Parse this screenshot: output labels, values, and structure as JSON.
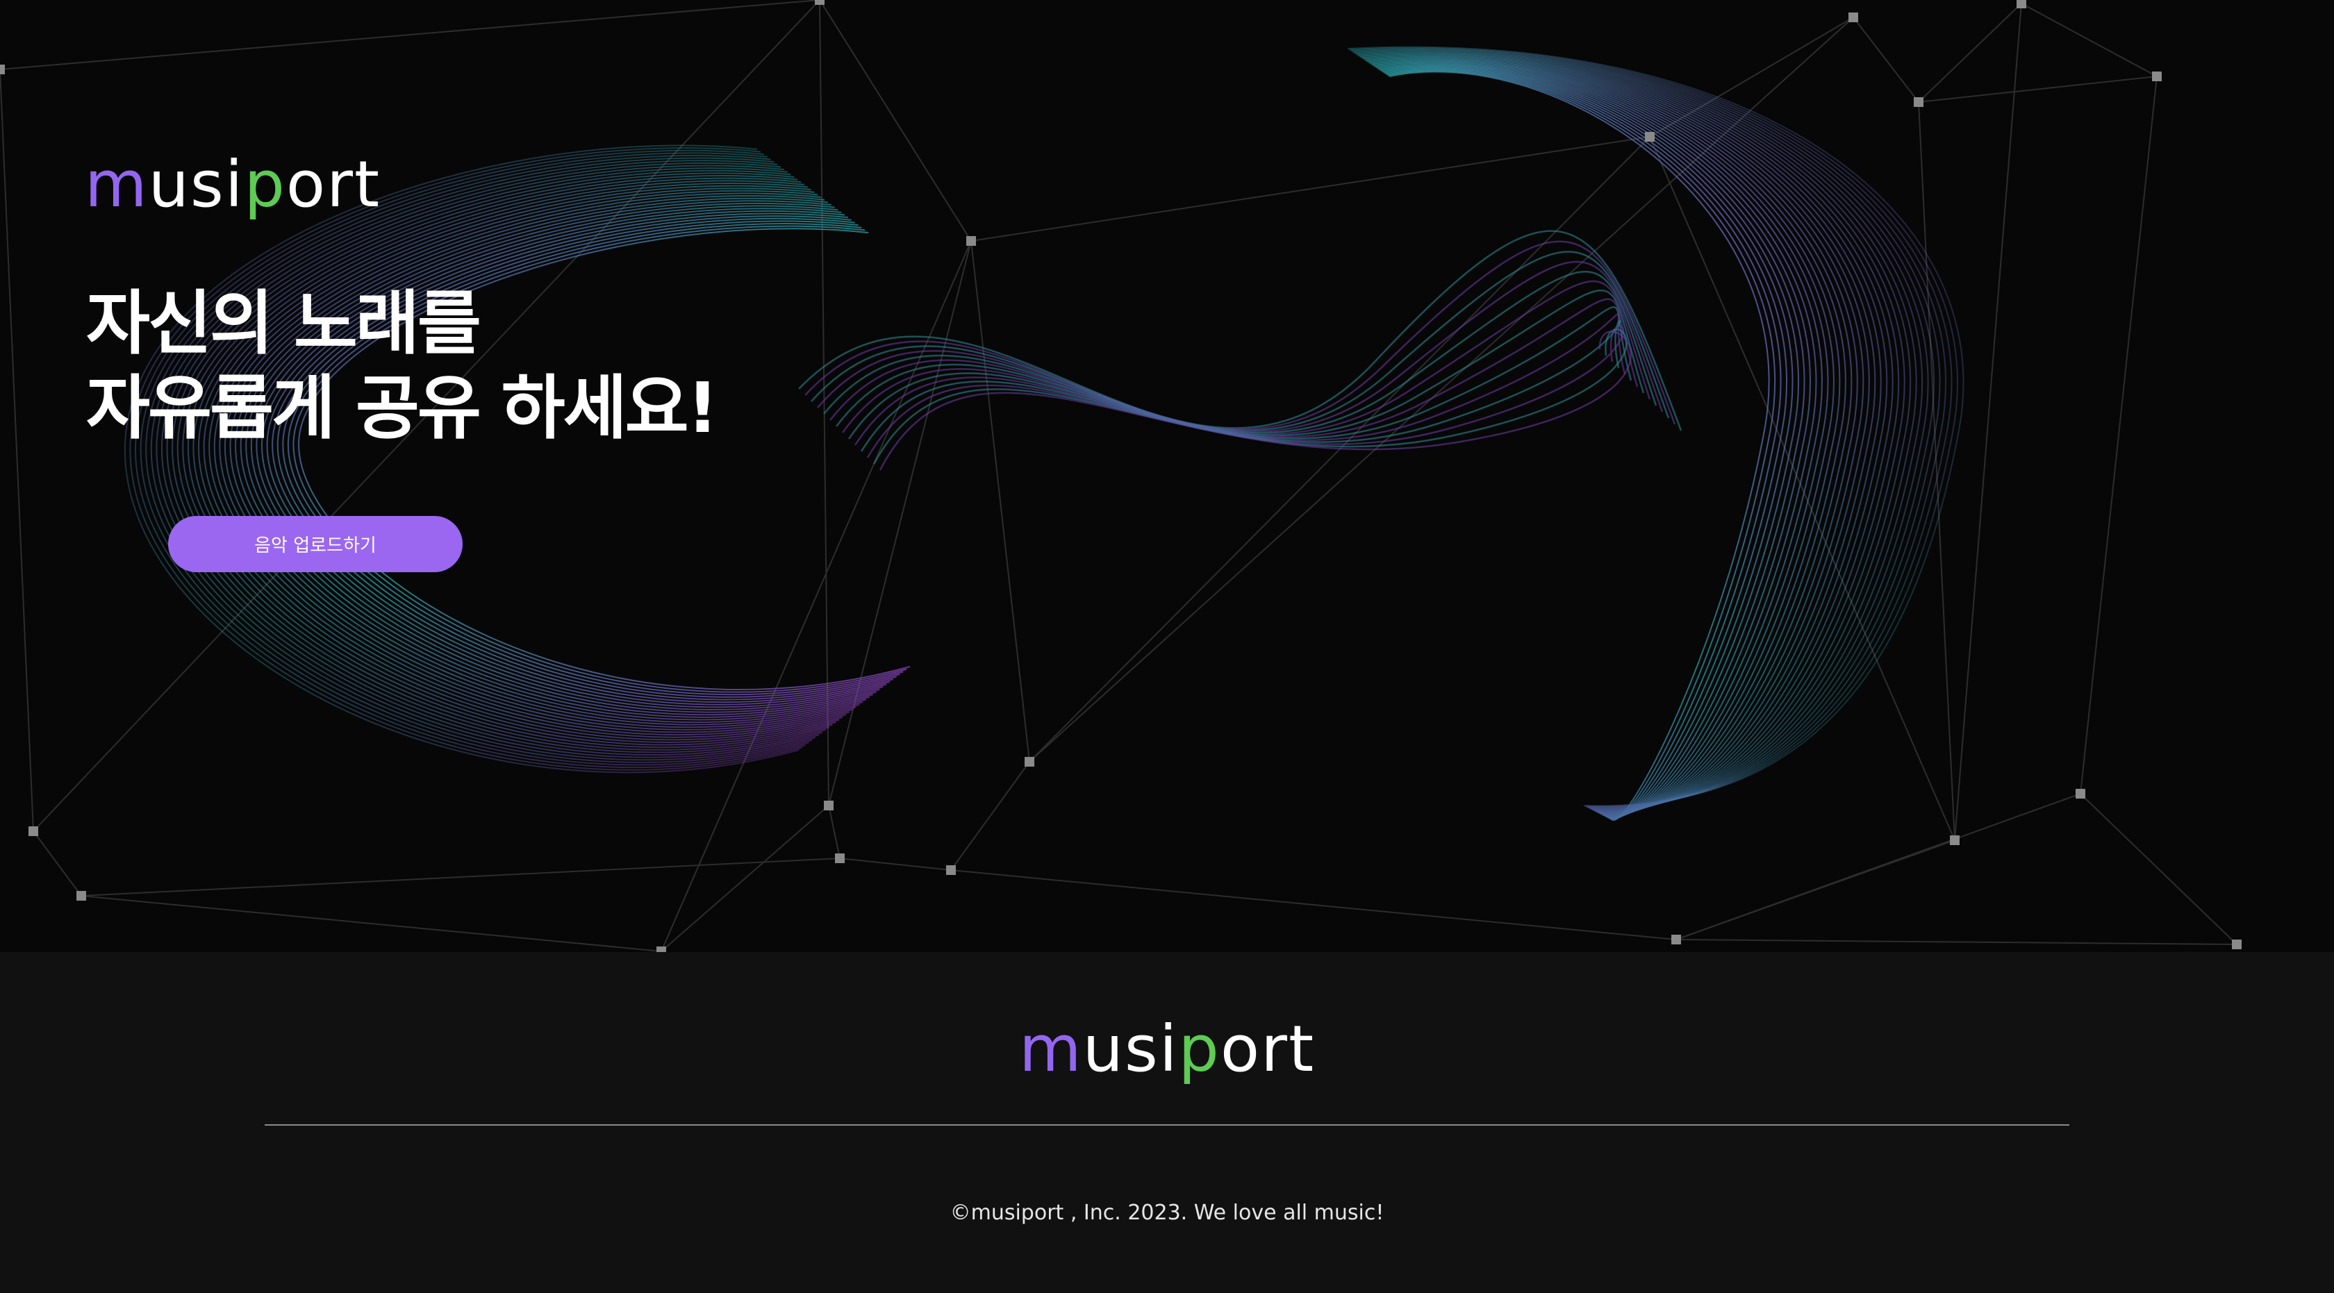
{
  "brand": {
    "logo_m": "m",
    "logo_usi": "usi",
    "logo_p": "p",
    "logo_ort": "ort",
    "accent_purple": "#9466f0",
    "accent_green": "#5ecb54"
  },
  "hero": {
    "headline_line1": "자신의 노래를",
    "headline_line2": "자유롭게 공유 하세요!",
    "upload_button_label": "음악 업로드하기",
    "background_graphic": "network-lines-and-sound-wave-art"
  },
  "footer": {
    "copyright": "©musiport , Inc. 2023. We love all music!"
  }
}
